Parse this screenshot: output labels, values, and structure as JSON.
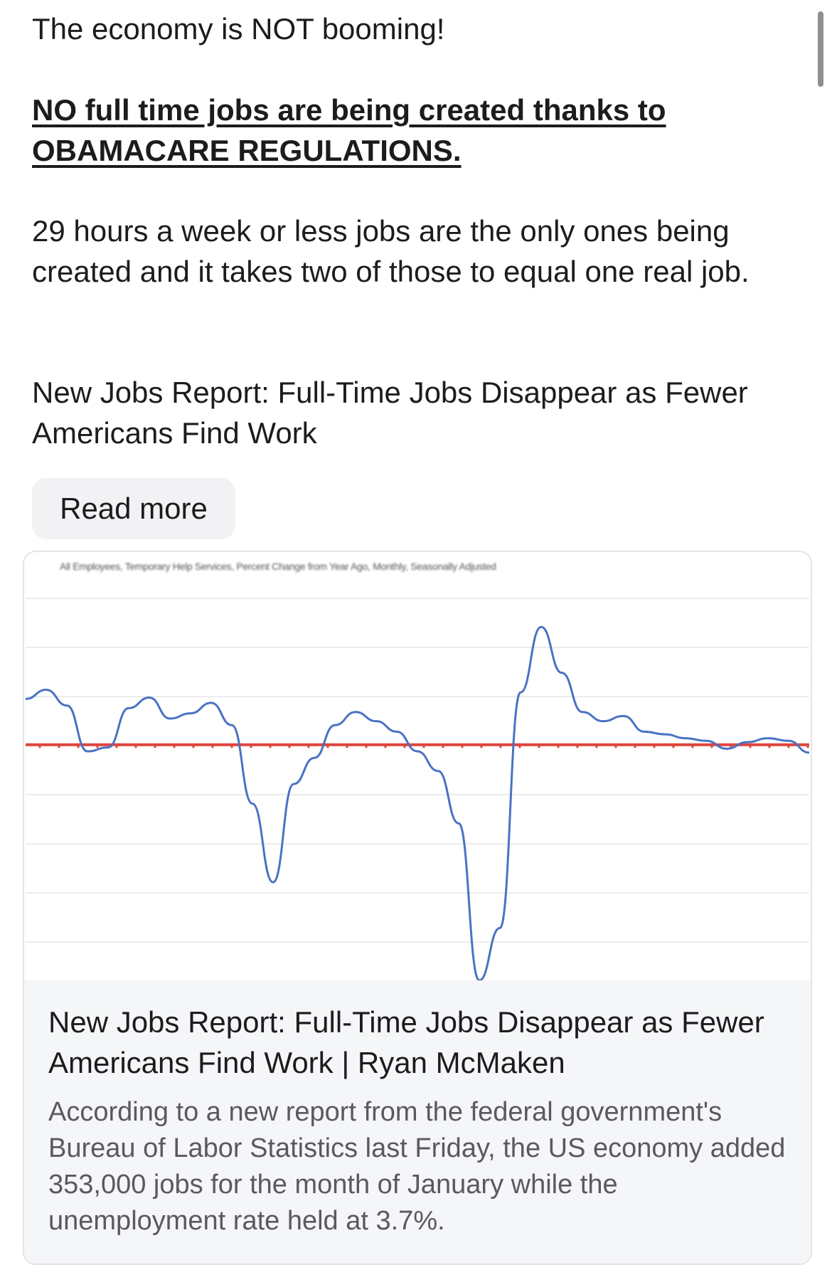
{
  "post": {
    "line1": "The economy is NOT booming!",
    "line2": "NO full time jobs are being created thanks to OBAMACARE REGULATIONS.",
    "line3": "29 hours a week or less jobs are the only ones being created and it takes two of those to equal one real job.",
    "line4": "New Jobs Report: Full-Time Jobs Disappear as Fewer Americans Find Work",
    "read_more_label": "Read more"
  },
  "link_card": {
    "title": "New Jobs Report: Full-Time Jobs Disappear as Fewer Americans Find Work | Ryan McMaken",
    "description": "According to a new report from the federal government's Bureau of Labor Statistics last Friday, the US economy added 353,000 jobs for the month of January while the unemployment rate held at 3.7%."
  },
  "chart_data": {
    "type": "line",
    "title": "All Employees, Temporary Help Services, Percent Change from Year Ago, Monthly, Seasonally Adjusted",
    "series_color": "#4a72c4",
    "zero_line_color": "#e0443e",
    "grid": true,
    "series": [
      {
        "values": [
          3.5,
          4.2,
          3.0,
          -0.5,
          -0.2,
          2.8,
          3.6,
          2.0,
          2.4,
          3.2,
          1.5,
          -4.5,
          -10.5,
          -3.0,
          -1.0,
          1.5,
          2.5,
          1.8,
          1.0,
          -0.5,
          -2.0,
          -6.0,
          -18.0,
          -14.0,
          4.0,
          9.0,
          5.5,
          2.5,
          1.8,
          2.2,
          1.0,
          0.8,
          0.5,
          0.3,
          -0.3,
          0.2,
          0.5,
          0.3,
          -0.6
        ]
      }
    ],
    "zero_line": 0,
    "ylim": [
      -18,
      12
    ]
  }
}
